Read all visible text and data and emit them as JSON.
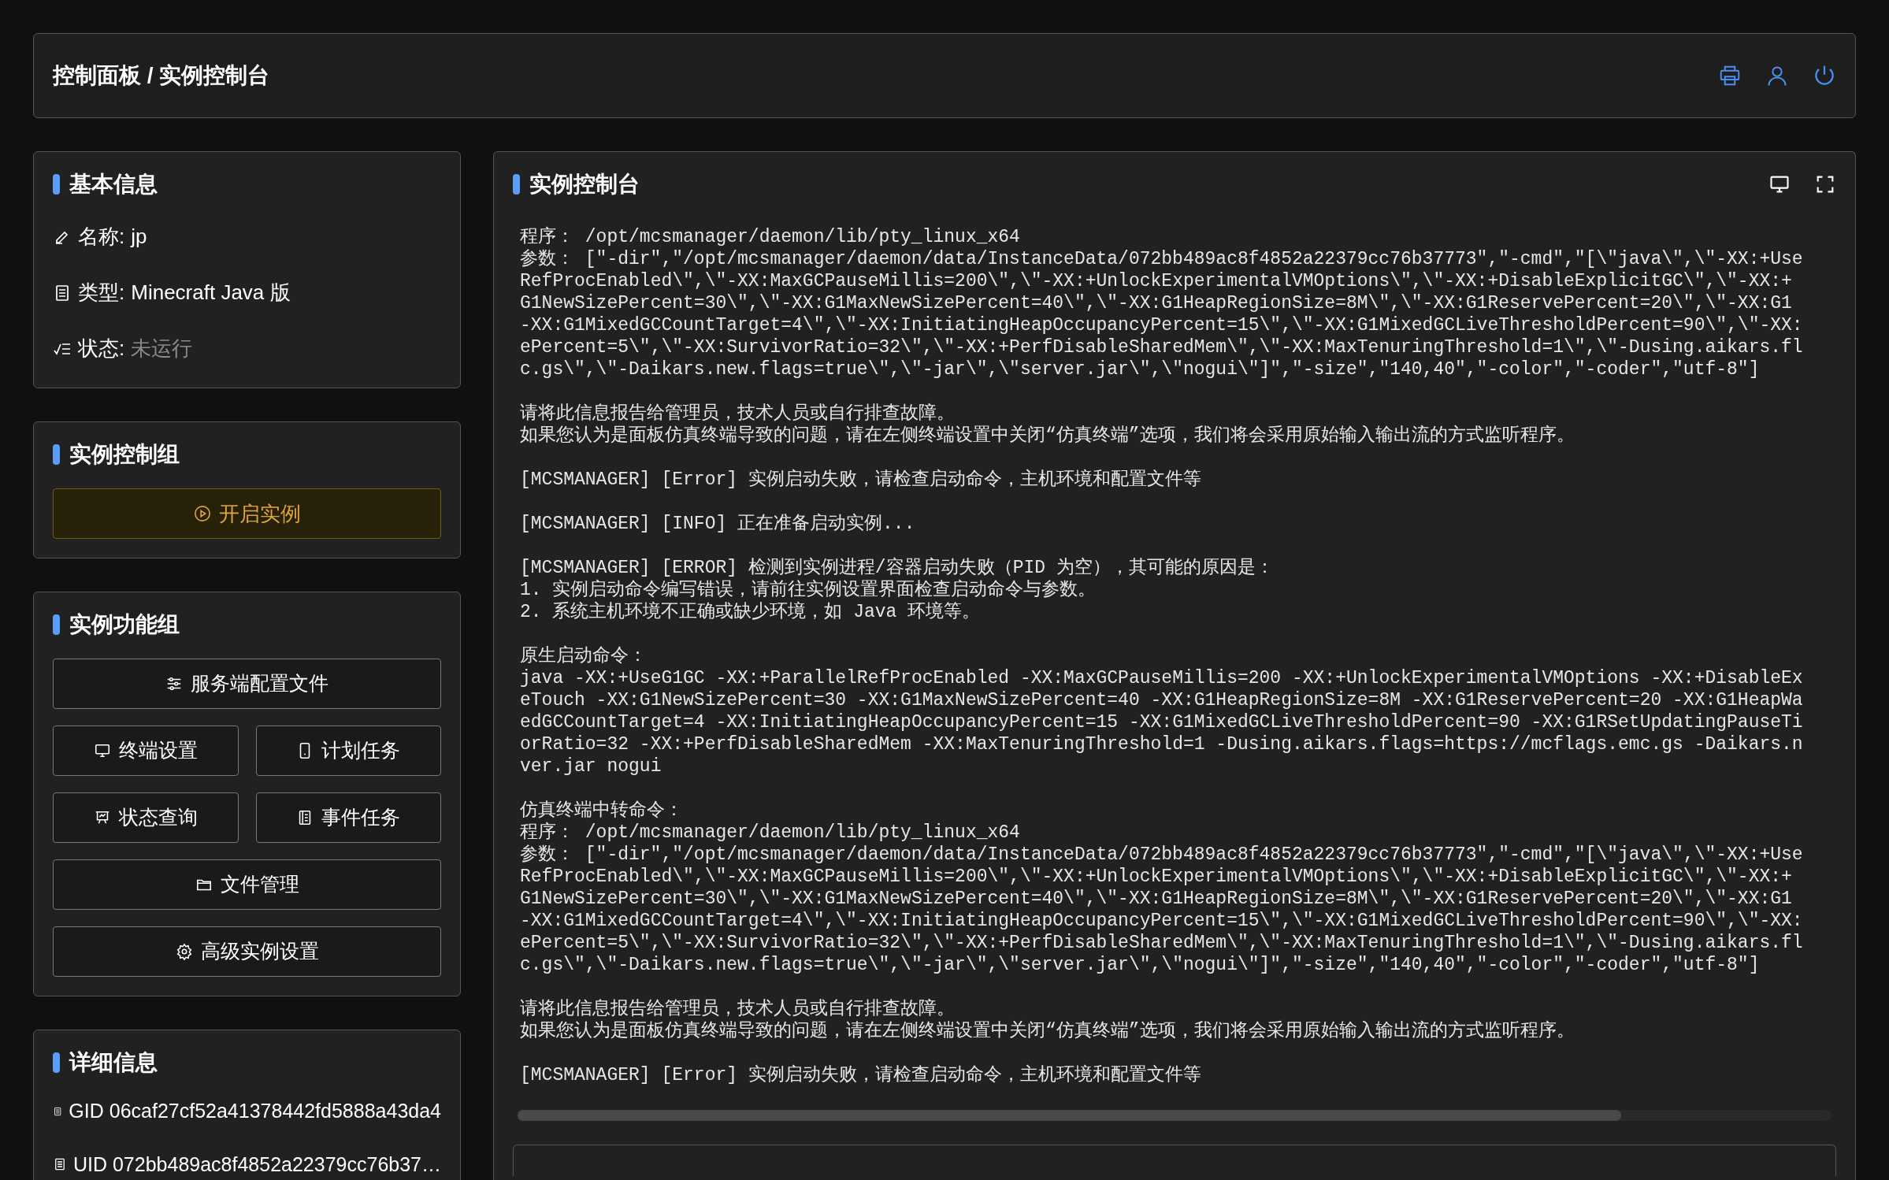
{
  "header": {
    "breadcrumb": "控制面板 / 实例控制台"
  },
  "basic_info": {
    "title": "基本信息",
    "items": [
      {
        "kind": "name",
        "label": "名称:",
        "value": "jp",
        "running": true
      },
      {
        "kind": "type",
        "label": "类型:",
        "value": "Minecraft Java 版",
        "running": true
      },
      {
        "kind": "status",
        "label": "状态:",
        "value": "未运行",
        "running": false
      }
    ]
  },
  "control_group": {
    "title": "实例控制组",
    "start_button": "开启实例"
  },
  "function_group": {
    "title": "实例功能组",
    "buttons": [
      {
        "kind": "config",
        "label": "服务端配置文件",
        "wide": true
      },
      {
        "kind": "terminal",
        "label": "终端设置",
        "wide": false
      },
      {
        "kind": "schedule",
        "label": "计划任务",
        "wide": false
      },
      {
        "kind": "status",
        "label": "状态查询",
        "wide": false
      },
      {
        "kind": "event",
        "label": "事件任务",
        "wide": false
      },
      {
        "kind": "files",
        "label": "文件管理",
        "wide": true
      },
      {
        "kind": "advanced",
        "label": "高级实例设置",
        "wide": true
      }
    ]
  },
  "details": {
    "title": "详细信息",
    "items": [
      "GID 06caf27cf52a41378442fd5888a43da4",
      "UID 072bb489ac8f4852a22379cc76b37…"
    ]
  },
  "console": {
    "title": "实例控制台",
    "blocks": [
      [
        "程序： /opt/mcsmanager/daemon/lib/pty_linux_x64",
        "参数： [\"-dir\",\"/opt/mcsmanager/daemon/data/InstanceData/072bb489ac8f4852a22379cc76b37773\",\"-cmd\",\"[\\\"java\\\",\\\"-XX:+Use",
        "RefProcEnabled\\\",\\\"-XX:MaxGCPauseMillis=200\\\",\\\"-XX:+UnlockExperimentalVMOptions\\\",\\\"-XX:+DisableExplicitGC\\\",\\\"-XX:+",
        "G1NewSizePercent=30\\\",\\\"-XX:G1MaxNewSizePercent=40\\\",\\\"-XX:G1HeapRegionSize=8M\\\",\\\"-XX:G1ReservePercent=20\\\",\\\"-XX:G1",
        "-XX:G1MixedGCCountTarget=4\\\",\\\"-XX:InitiatingHeapOccupancyPercent=15\\\",\\\"-XX:G1MixedGCLiveThresholdPercent=90\\\",\\\"-XX:",
        "ePercent=5\\\",\\\"-XX:SurvivorRatio=32\\\",\\\"-XX:+PerfDisableSharedMem\\\",\\\"-XX:MaxTenuringThreshold=1\\\",\\\"-Dusing.aikars.fl",
        "c.gs\\\",\\\"-Daikars.new.flags=true\\\",\\\"-jar\\\",\\\"server.jar\\\",\\\"nogui\\\"]\",\"-size\",\"140,40\",\"-color\",\"-coder\",\"utf-8\"]"
      ],
      [
        "请将此信息报告给管理员，技术人员或自行排查故障。",
        "如果您认为是面板仿真终端导致的问题，请在左侧终端设置中关闭“仿真终端”选项，我们将会采用原始输入输出流的方式监听程序。"
      ],
      [
        "[MCSMANAGER] [Error] 实例启动失败，请检查启动命令，主机环境和配置文件等"
      ],
      [
        "[MCSMANAGER] [INFO] 正在准备启动实例..."
      ],
      [
        "[MCSMANAGER] [ERROR] 检测到实例进程/容器启动失败（PID 为空），其可能的原因是：",
        "1. 实例启动命令编写错误，请前往实例设置界面检查启动命令与参数。",
        "2. 系统主机环境不正确或缺少环境，如 Java 环境等。"
      ],
      [
        "原生启动命令：",
        "java -XX:+UseG1GC -XX:+ParallelRefProcEnabled -XX:MaxGCPauseMillis=200 -XX:+UnlockExperimentalVMOptions -XX:+DisableEx",
        "eTouch -XX:G1NewSizePercent=30 -XX:G1MaxNewSizePercent=40 -XX:G1HeapRegionSize=8M -XX:G1ReservePercent=20 -XX:G1HeapWa",
        "edGCCountTarget=4 -XX:InitiatingHeapOccupancyPercent=15 -XX:G1MixedGCLiveThresholdPercent=90 -XX:G1RSetUpdatingPauseTi",
        "orRatio=32 -XX:+PerfDisableSharedMem -XX:MaxTenuringThreshold=1 -Dusing.aikars.flags=https://mcflags.emc.gs -Daikars.n",
        "ver.jar nogui"
      ],
      [
        "仿真终端中转命令：",
        "程序： /opt/mcsmanager/daemon/lib/pty_linux_x64",
        "参数： [\"-dir\",\"/opt/mcsmanager/daemon/data/InstanceData/072bb489ac8f4852a22379cc76b37773\",\"-cmd\",\"[\\\"java\\\",\\\"-XX:+Use",
        "RefProcEnabled\\\",\\\"-XX:MaxGCPauseMillis=200\\\",\\\"-XX:+UnlockExperimentalVMOptions\\\",\\\"-XX:+DisableExplicitGC\\\",\\\"-XX:+",
        "G1NewSizePercent=30\\\",\\\"-XX:G1MaxNewSizePercent=40\\\",\\\"-XX:G1HeapRegionSize=8M\\\",\\\"-XX:G1ReservePercent=20\\\",\\\"-XX:G1",
        "-XX:G1MixedGCCountTarget=4\\\",\\\"-XX:InitiatingHeapOccupancyPercent=15\\\",\\\"-XX:G1MixedGCLiveThresholdPercent=90\\\",\\\"-XX:",
        "ePercent=5\\\",\\\"-XX:SurvivorRatio=32\\\",\\\"-XX:+PerfDisableSharedMem\\\",\\\"-XX:MaxTenuringThreshold=1\\\",\\\"-Dusing.aikars.fl",
        "c.gs\\\",\\\"-Daikars.new.flags=true\\\",\\\"-jar\\\",\\\"server.jar\\\",\\\"nogui\\\"]\",\"-size\",\"140,40\",\"-color\",\"-coder\",\"utf-8\"]"
      ],
      [
        "请将此信息报告给管理员，技术人员或自行排查故障。",
        "如果您认为是面板仿真终端导致的问题，请在左侧终端设置中关闭“仿真终端”选项，我们将会采用原始输入输出流的方式监听程序。"
      ],
      [
        "[MCSMANAGER] [Error] 实例启动失败，请检查启动命令，主机环境和配置文件等"
      ]
    ]
  }
}
